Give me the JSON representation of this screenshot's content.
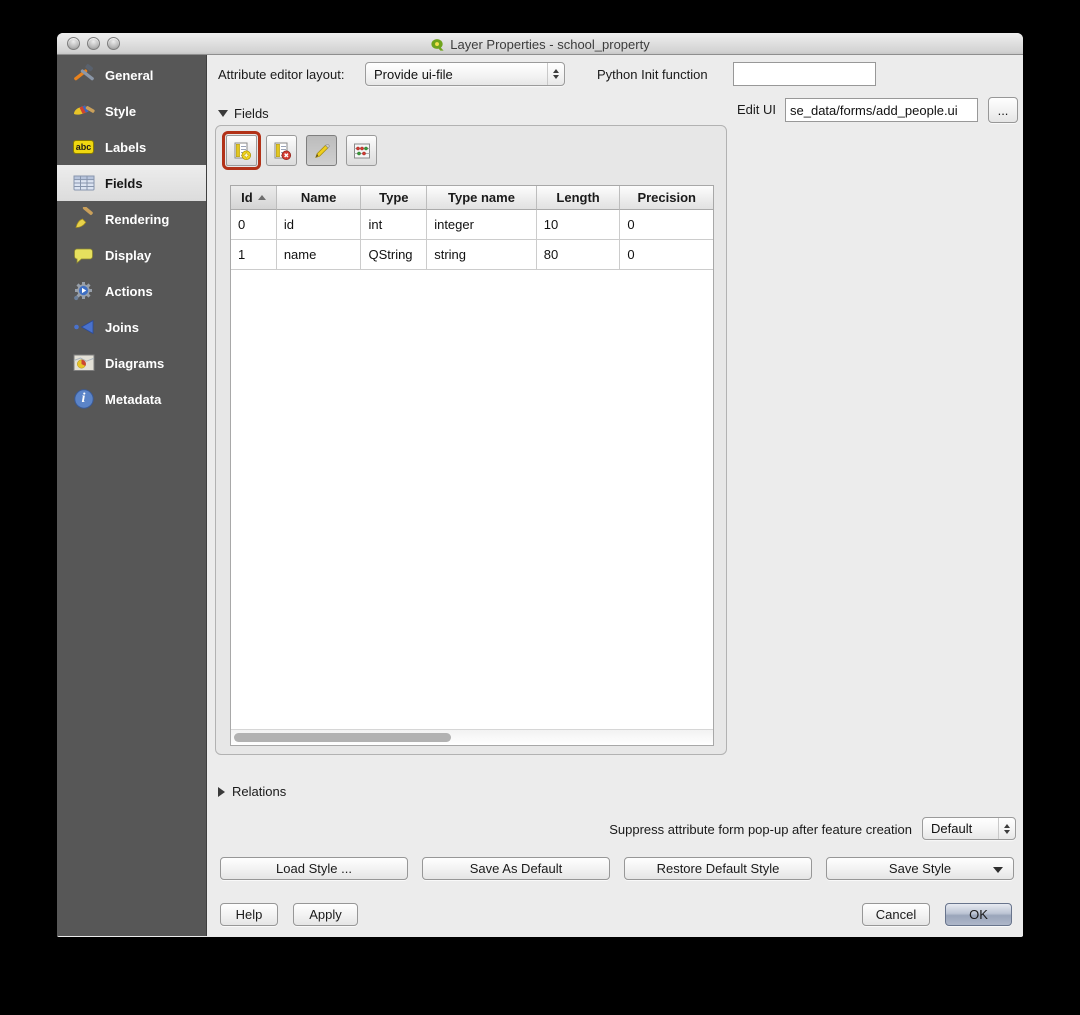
{
  "window": {
    "title": "Layer Properties - school_property"
  },
  "titlebar": {
    "buttons": [
      "close",
      "minimize",
      "zoom"
    ]
  },
  "sidebar": {
    "items": [
      {
        "label": "General",
        "icon": "tools-icon"
      },
      {
        "label": "Style",
        "icon": "paintbrush-icon"
      },
      {
        "label": "Labels",
        "icon": "abc-badge-icon",
        "icon_text": "abc"
      },
      {
        "label": "Fields",
        "icon": "table-icon",
        "selected": true
      },
      {
        "label": "Rendering",
        "icon": "brush-icon"
      },
      {
        "label": "Display",
        "icon": "speech-bubble-icon"
      },
      {
        "label": "Actions",
        "icon": "gear-play-icon"
      },
      {
        "label": "Joins",
        "icon": "join-arrow-icon"
      },
      {
        "label": "Diagrams",
        "icon": "diagram-icon"
      },
      {
        "label": "Metadata",
        "icon": "info-icon",
        "icon_text": "i"
      }
    ]
  },
  "topbar": {
    "attribute_editor_layout_label": "Attribute editor layout:",
    "attribute_editor_layout_value": "Provide ui-file",
    "python_init_label": "Python Init function",
    "python_init_value": "",
    "edit_ui_label": "Edit UI",
    "edit_ui_value": "se_data/forms/add_people.ui",
    "browse_button_label": "..."
  },
  "fields_section": {
    "title": "Fields",
    "toolbar": [
      {
        "name": "new-column-button",
        "highlighted": true
      },
      {
        "name": "delete-column-button"
      },
      {
        "name": "toggle-editing-button",
        "pressed": true
      },
      {
        "name": "field-calculator-button"
      }
    ],
    "table": {
      "columns": [
        "Id",
        "Name",
        "Type",
        "Type name",
        "Length",
        "Precision"
      ],
      "sort": {
        "column": "Id",
        "direction": "ascending"
      },
      "rows": [
        [
          "0",
          "id",
          "int",
          "integer",
          "10",
          "0"
        ],
        [
          "1",
          "name",
          "QString",
          "string",
          "80",
          "0"
        ]
      ]
    }
  },
  "relations_section": {
    "title": "Relations",
    "collapsed": true
  },
  "suppress": {
    "label": "Suppress attribute form pop-up after feature creation",
    "value": "Default"
  },
  "style_buttons": [
    "Load Style ...",
    "Save As Default",
    "Restore Default Style",
    "Save Style"
  ],
  "dialog_buttons": {
    "help": "Help",
    "apply": "Apply",
    "cancel": "Cancel",
    "ok": "OK"
  },
  "colors": {
    "annotation_red": "#b23218",
    "sidebar_bg": "#575757",
    "sidebar_selected_bg": "#e4e4e4",
    "dialog_bg": "#ececec",
    "ok_button": "#9aa5ba"
  }
}
